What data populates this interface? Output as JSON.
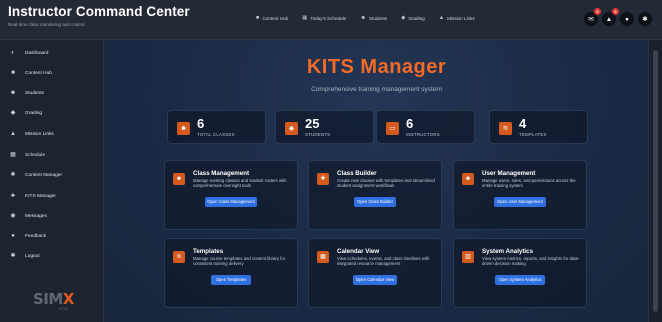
{
  "header": {
    "title": "Instructor Command Center",
    "subtitle": "Real-time class monitoring and control",
    "nav": [
      {
        "label": "Content Hub",
        "icon": "film-icon",
        "glyph": "■"
      },
      {
        "label": "Today's Schedule",
        "icon": "calendar-icon",
        "glyph": "▦"
      },
      {
        "label": "Students",
        "icon": "users-icon",
        "glyph": "☻"
      },
      {
        "label": "Grading",
        "icon": "graduation-cap-icon",
        "glyph": "◆"
      },
      {
        "label": "Mission Links",
        "icon": "building-icon",
        "glyph": "▲"
      }
    ],
    "actions": [
      {
        "name": "messages-button",
        "icon": "envelope-icon",
        "glyph": "✉",
        "badge": "0"
      },
      {
        "name": "notifications-button",
        "icon": "bell-icon",
        "glyph": "▲",
        "badge": "0"
      },
      {
        "name": "profile-button",
        "icon": "user-icon",
        "glyph": "●",
        "badge": ""
      },
      {
        "name": "settings-button",
        "icon": "gear-icon",
        "glyph": "✱",
        "badge": ""
      }
    ]
  },
  "sidebar": {
    "items": [
      {
        "label": "Dashboard",
        "icon": "dashboard-icon",
        "glyph": "◐"
      },
      {
        "label": "Content Hub",
        "icon": "film-icon",
        "glyph": "■"
      },
      {
        "label": "Students",
        "icon": "users-icon",
        "glyph": "☻"
      },
      {
        "label": "Grading",
        "icon": "graduation-cap-icon",
        "glyph": "◆"
      },
      {
        "label": "Mission Links",
        "icon": "building-icon",
        "glyph": "▲"
      },
      {
        "label": "Schedule",
        "icon": "calendar-icon",
        "glyph": "▦"
      },
      {
        "label": "Content Manager",
        "icon": "gear-icon",
        "glyph": "✱"
      },
      {
        "label": "KITS Manager",
        "icon": "users-gear-icon",
        "glyph": "♣"
      },
      {
        "label": "Messages",
        "icon": "chat-icon",
        "glyph": "◉"
      },
      {
        "label": "Feedback",
        "icon": "comment-icon",
        "glyph": "●"
      },
      {
        "label": "Logout",
        "icon": "logout-icon",
        "glyph": "✱"
      }
    ],
    "logo": {
      "main_a": "SIM",
      "main_b": "X",
      "sub": "KITS"
    }
  },
  "main": {
    "title": "KITS Manager",
    "subtitle": "Comprehensive training management system",
    "stats": [
      {
        "value": "6",
        "label": "TOTAL CLASSES",
        "icon": "users-icon",
        "glyph": "☻"
      },
      {
        "value": "25",
        "label": "STUDENTS",
        "icon": "graduation-cap-icon",
        "glyph": "◆"
      },
      {
        "value": "6",
        "label": "INSTRUCTORS",
        "icon": "presentation-icon",
        "glyph": "▭"
      },
      {
        "value": "4",
        "label": "TEMPLATES",
        "icon": "layers-icon",
        "glyph": "≋"
      }
    ],
    "cards": [
      {
        "title": "Class Management",
        "desc": "Manage existing classes and student rosters with comprehensive oversight tools",
        "button": "Open Class Management",
        "icon": "users-icon",
        "glyph": "☻"
      },
      {
        "title": "Class Builder",
        "desc": "Create new classes with templates and streamlined student assignment workflows",
        "button": "Open Class Builder",
        "icon": "plus-circle-icon",
        "glyph": "✚"
      },
      {
        "title": "User Management",
        "desc": "Manage users, roles, and permissions across the entire training system",
        "button": "Open User Management",
        "icon": "user-cog-icon",
        "glyph": "☻"
      },
      {
        "title": "Templates",
        "desc": "Manage course templates and content library for consistent training delivery",
        "button": "Open Templates",
        "icon": "layers-icon",
        "glyph": "≋"
      },
      {
        "title": "Calendar View",
        "desc": "View schedules, events, and class timelines with integrated resource management",
        "button": "Open Calendar View",
        "icon": "calendar-icon",
        "glyph": "▦"
      },
      {
        "title": "System Analytics",
        "desc": "View system metrics, reports, and insights for data-driven decision making",
        "button": "Open System Analytics",
        "icon": "chart-icon",
        "glyph": "▥"
      }
    ]
  },
  "colors": {
    "accent": "#f26a25",
    "button": "#2f6fe0",
    "badge": "#e53935"
  }
}
